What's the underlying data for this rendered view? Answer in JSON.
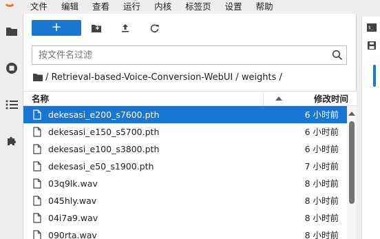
{
  "menubar": {
    "items": [
      "文件",
      "编辑",
      "查看",
      "运行",
      "内核",
      "标签页",
      "设置",
      "帮助"
    ]
  },
  "toolbar": {
    "new_label": "+"
  },
  "search": {
    "placeholder": "按文件名过滤"
  },
  "breadcrumb": {
    "path": "/ Retrieval-based-Voice-Conversion-WebUI / weights /"
  },
  "header": {
    "name": "名称",
    "modified": "修改时间"
  },
  "files": [
    {
      "name": "dekesasi_e200_s7600.pth",
      "modified": "6 小时前",
      "selected": true
    },
    {
      "name": "dekesasi_e150_s5700.pth",
      "modified": "6 小时前",
      "selected": false
    },
    {
      "name": "dekesasi_e100_s3800.pth",
      "modified": "6 小时前",
      "selected": false
    },
    {
      "name": "dekesasi_e50_s1900.pth",
      "modified": "7 小时前",
      "selected": false
    },
    {
      "name": "03q9lk.wav",
      "modified": "8 小时前",
      "selected": false
    },
    {
      "name": "045hly.wav",
      "modified": "8 小时前",
      "selected": false
    },
    {
      "name": "04i7a9.wav",
      "modified": "8 小时前",
      "selected": false
    },
    {
      "name": "090rta.wav",
      "modified": "8 小时前",
      "selected": false
    }
  ],
  "colors": {
    "accent": "#1976d2",
    "logo": "#f37626"
  }
}
